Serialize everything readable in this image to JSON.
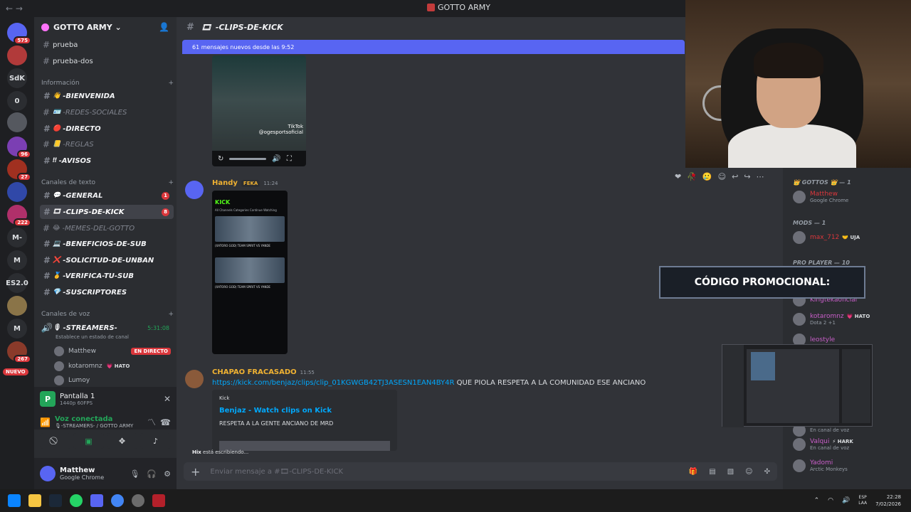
{
  "window": {
    "title": "GOTTO ARMY",
    "nav": "←  →"
  },
  "rail": {
    "servers": [
      {
        "label": "",
        "badge": "575",
        "color": "#5865f2"
      },
      {
        "label": "",
        "badge": "",
        "color": "#b13a3a"
      },
      {
        "label": "SdK",
        "badge": "",
        "color": "#2b2d31"
      },
      {
        "label": "0",
        "badge": "",
        "color": "#2b2d31"
      },
      {
        "label": "",
        "badge": "",
        "color": "#55585f"
      },
      {
        "label": "",
        "badge": "96",
        "color": "#7b3fb3"
      },
      {
        "label": "",
        "badge": "27",
        "color": "#a03020"
      },
      {
        "label": "",
        "badge": "",
        "color": "#3048a8"
      },
      {
        "label": "",
        "badge": "222",
        "color": "#b0306a"
      },
      {
        "label": "M-",
        "badge": "",
        "color": "#2b2d31"
      },
      {
        "label": "M",
        "badge": "",
        "color": "#2b2d31"
      },
      {
        "label": "ES2.0",
        "badge": "",
        "color": "#2b2d31"
      },
      {
        "label": "",
        "badge": "",
        "color": "#8a7448"
      },
      {
        "label": "M",
        "badge": "",
        "color": "#2b2d31"
      },
      {
        "label": "",
        "badge": "267",
        "color": "#8a3a2a"
      }
    ],
    "new_label": "NUEVO"
  },
  "sidebar": {
    "server_name": "GOTTO ARMY",
    "top_channels": [
      {
        "name": "prueba"
      },
      {
        "name": "prueba-dos"
      }
    ],
    "categories": {
      "info": "Información",
      "text": "Canales de texto",
      "voice": "Canales de voz"
    },
    "info_channels": [
      {
        "emoji": "👋",
        "name": "-BIENVENIDA"
      },
      {
        "emoji": "🪪",
        "name": "-REDES-SOCIALES"
      },
      {
        "emoji": "🔴",
        "name": "-DIRECTO"
      },
      {
        "emoji": "📒",
        "name": "-REGLAS"
      },
      {
        "emoji": "‼",
        "name": "-AVISOS"
      }
    ],
    "text_channels": [
      {
        "emoji": "💬",
        "name": "-GENERAL",
        "count": "1"
      },
      {
        "emoji": "🎞",
        "name": "-CLIPS-DE-KICK",
        "count": "8"
      },
      {
        "emoji": "😂",
        "name": "-MEMES-DEL-GOTTO",
        "count": ""
      },
      {
        "emoji": "💻",
        "name": "-BENEFICIOS-DE-SUB",
        "count": ""
      },
      {
        "emoji": "❌",
        "name": "-SOLICITUD-DE-UNBAN",
        "count": ""
      },
      {
        "emoji": "🥇",
        "name": "-VERIFICA-TU-SUB",
        "count": ""
      },
      {
        "emoji": "💎",
        "name": "-SUSCRIPTORES",
        "count": ""
      }
    ],
    "voice_channel": {
      "emoji": "🎙",
      "name": "-STREAMERS-",
      "timer": "5:31:08",
      "status_hint": "Establece un estado de canal",
      "users": [
        {
          "name": "Matthew",
          "badge": "EN DIRECTO"
        },
        {
          "name": "kotaromnz",
          "badge": "💗 HATO"
        },
        {
          "name": "Lumoy",
          "badge": ""
        }
      ]
    },
    "screenshare": {
      "title": "Pantalla 1",
      "subtitle": "1440p 60FPS",
      "status": "Voz conectada",
      "location": "🎙-STREAMERS- / GOTTO ARMY"
    },
    "user": {
      "name": "Matthew",
      "status": "Google Chrome"
    }
  },
  "chat": {
    "channel_emoji": "🎞",
    "channel_name": "-CLIPS-DE-KICK",
    "new_messages": "61 mensajes nuevos desde las 9:52",
    "video": {
      "progress": 0,
      "watermark": "TikTok",
      "handle": "@ogesportsoficial"
    },
    "messages": [
      {
        "author": "Handy",
        "author_color": "#f0b232",
        "tag": "FEKA",
        "time": "11:24",
        "phone": {
          "brand": "KICK",
          "tabs": "All   Channels   Categories   Continue Watching",
          "lines": [
            "(XATORO GOD) TEAM SPIRIT VS YANDE",
            "(XATORO GOD) TEAM SPIRIT VS YANDE"
          ]
        }
      },
      {
        "author": "CHAPAO FRACASADO",
        "author_color": "#f0b232",
        "time": "11:55",
        "link": "https://kick.com/benjaz/clips/clip_01KGWGB42TJ3ASESN1EAN4BY4R",
        "text": "QUE PIOLA RESPETA A LA COMUNIDAD ESE ANCIANO",
        "embed": {
          "provider": "Kick",
          "title": "Benjaz - Watch clips on Kick",
          "description": "RESPETA A LA GENTE ANCIANO DE MRD"
        }
      }
    ],
    "typing": {
      "user": "Hix",
      "suffix": " está escribiendo..."
    },
    "composer_placeholder": "Enviar mensaje a #🎞-CLIPS-DE-KICK"
  },
  "members": {
    "groups": [
      {
        "title": "👑 GOTTOS 👑 — 1"
      },
      {
        "title": "MODS — 1"
      },
      {
        "title": "PRO PLAYER — 10"
      }
    ],
    "entries": [
      {
        "name": "Matthew",
        "sub": "Google Chrome",
        "color": "#da373c",
        "tag": ""
      },
      {
        "name": "max_712",
        "sub": "",
        "color": "#da373c",
        "tag": "🤝 UJA"
      },
      {
        "name": "Kingtekaoficial",
        "sub": "",
        "color": "#c95ec9",
        "tag": ""
      },
      {
        "name": "kotaromnz",
        "sub": "Dota 2 +1",
        "color": "#c95ec9",
        "tag": "💗 HATO"
      },
      {
        "name": "leostyle",
        "sub": "",
        "color": "#c95ec9",
        "tag": ""
      },
      {
        "name": "",
        "sub": "En canal de voz",
        "color": "#c95ec9",
        "tag": ""
      },
      {
        "name": "Valqui",
        "sub": "En canal de voz",
        "color": "#c95ec9",
        "tag": "⚡ HARK"
      },
      {
        "name": "Yadomi",
        "sub": "Arctic Monkeys",
        "color": "#c95ec9",
        "tag": ""
      }
    ]
  },
  "overlay": {
    "promo": "CÓDIGO PROMOCIONAL:"
  },
  "taskbar": {
    "lang_top": "ESP",
    "lang_bottom": "LAA",
    "time": "22:28",
    "date": "7/02/2026"
  }
}
